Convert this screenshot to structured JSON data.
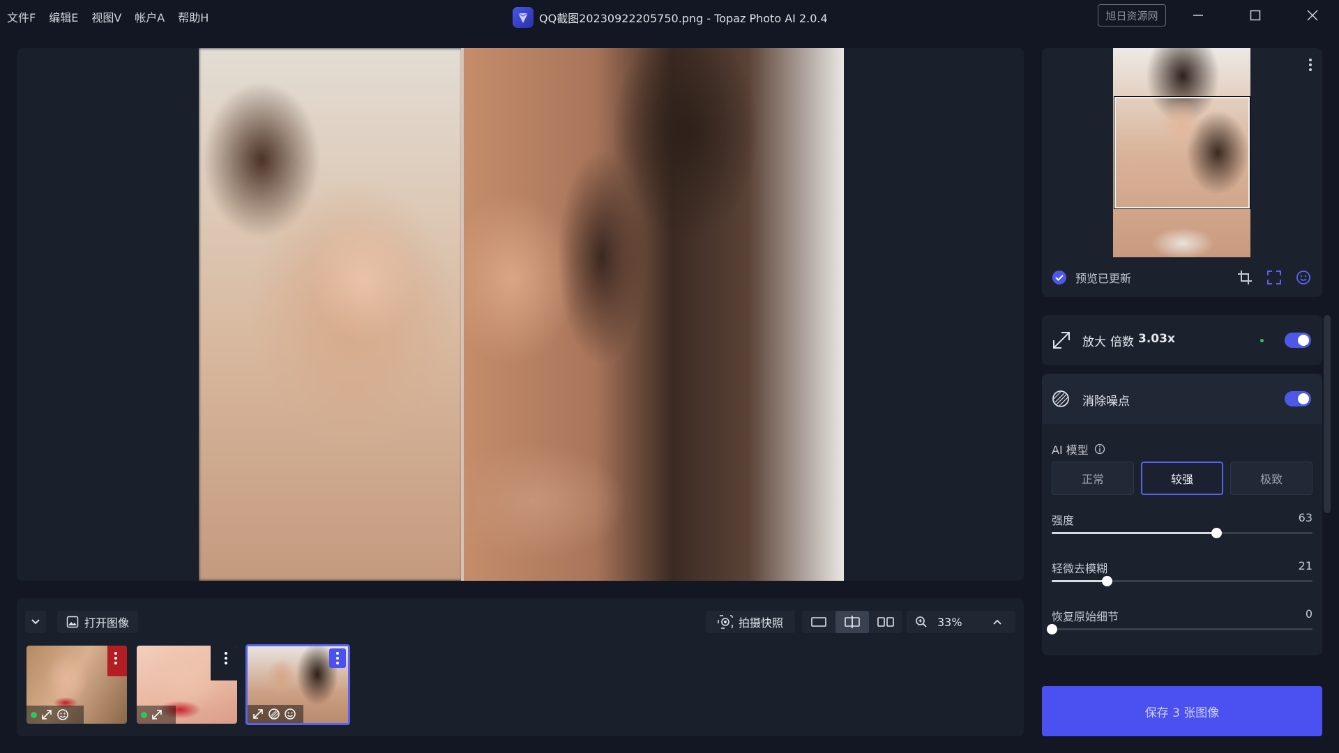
{
  "menu": [
    {
      "label": "文件F"
    },
    {
      "label": "编辑E"
    },
    {
      "label": "视图V"
    },
    {
      "label": "帐户A"
    },
    {
      "label": "帮助H"
    }
  ],
  "window": {
    "title": "QQ截图20230922205750.png - Topaz Photo AI 2.0.4",
    "watermark": "旭日资源网"
  },
  "toolbar": {
    "open_image": "打开图像",
    "snapshot": "拍摄快照",
    "zoom": "33%"
  },
  "thumbnails": [
    {
      "icons": [
        "status-dot",
        "upscale-icon",
        "face-icon"
      ],
      "selected": false
    },
    {
      "icons": [
        "status-dot",
        "upscale-icon"
      ],
      "selected": false
    },
    {
      "icons": [
        "upscale-icon",
        "denoise-icon",
        "face-icon"
      ],
      "selected": true
    }
  ],
  "preview": {
    "status": "预览已更新"
  },
  "upscale": {
    "label": "放大",
    "factor_label": "倍数",
    "factor": "3.03x",
    "enabled": true
  },
  "denoise": {
    "label": "消除噪点",
    "enabled": true,
    "model_label": "AI 模型",
    "models": [
      "正常",
      "较强",
      "极致"
    ],
    "selected_model": "较强",
    "sliders": [
      {
        "label": "强度",
        "value": "63",
        "level": 0.63
      },
      {
        "label": "轻微去模糊",
        "value": "21",
        "level": 0.21
      },
      {
        "label": "恢复原始细节",
        "value": "0",
        "level": 0
      }
    ]
  },
  "save": {
    "label": "保存 3 张图像"
  },
  "colors": {
    "accent": "#4b51f0",
    "background": "#121723",
    "panel": "#19202c",
    "status_green": "#2dc55c"
  }
}
